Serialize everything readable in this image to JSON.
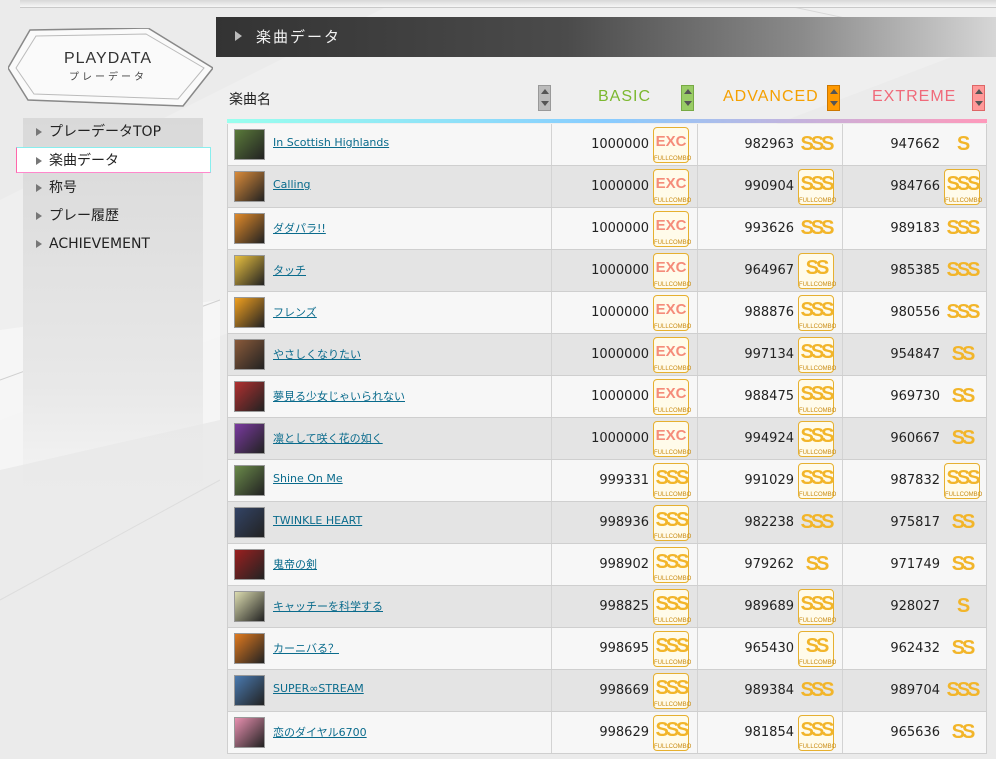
{
  "logo": {
    "title": "PLAYDATA",
    "subtitle": "プレーデータ"
  },
  "sidebar": {
    "items": [
      {
        "label": "プレーデータTOP",
        "active": false
      },
      {
        "label": "楽曲データ",
        "active": true
      },
      {
        "label": "称号",
        "active": false
      },
      {
        "label": "プレー履歴",
        "active": false
      },
      {
        "label": "ACHIEVEMENT",
        "active": false
      }
    ]
  },
  "header": {
    "title": "楽曲データ"
  },
  "table": {
    "col_song": "楽曲名",
    "col_basic": "BASIC",
    "col_advanced": "ADVANCED",
    "col_extreme": "EXTREME",
    "colors": {
      "basic": "#7cb82f",
      "advanced": "#f5a000",
      "extreme": "#f06a7a"
    },
    "rows": [
      {
        "title": "In Scottish Highlands",
        "jacket": "#5a7a3a",
        "basic": "1000000",
        "basic_rank": "EXC",
        "basic_fc": "FULLCOMBO",
        "advanced": "982963",
        "advanced_rank": "SSS",
        "advanced_fc": "",
        "extreme": "947662",
        "extreme_rank": "S",
        "extreme_fc": ""
      },
      {
        "title": "Calling",
        "jacket": "#d98b3a",
        "basic": "1000000",
        "basic_rank": "EXC",
        "basic_fc": "FULLCOMBO",
        "advanced": "990904",
        "advanced_rank": "SSS",
        "advanced_fc": "FULLCOMBO",
        "extreme": "984766",
        "extreme_rank": "SSS",
        "extreme_fc": "FULLCOMBO"
      },
      {
        "title": "ダダパラ!!",
        "jacket": "#e08a2a",
        "basic": "1000000",
        "basic_rank": "EXC",
        "basic_fc": "FULLCOMBO",
        "advanced": "993626",
        "advanced_rank": "SSS",
        "advanced_fc": "",
        "extreme": "989183",
        "extreme_rank": "SSS",
        "extreme_fc": ""
      },
      {
        "title": "タッチ",
        "jacket": "#e8c040",
        "basic": "1000000",
        "basic_rank": "EXC",
        "basic_fc": "FULLCOMBO",
        "advanced": "964967",
        "advanced_rank": "SS",
        "advanced_fc": "FULLCOMBO",
        "extreme": "985385",
        "extreme_rank": "SSS",
        "extreme_fc": ""
      },
      {
        "title": "フレンズ",
        "jacket": "#f0a020",
        "basic": "1000000",
        "basic_rank": "EXC",
        "basic_fc": "FULLCOMBO",
        "advanced": "988876",
        "advanced_rank": "SSS",
        "advanced_fc": "FULLCOMBO",
        "extreme": "980556",
        "extreme_rank": "SSS",
        "extreme_fc": ""
      },
      {
        "title": "やさしくなりたい",
        "jacket": "#8a5a3a",
        "basic": "1000000",
        "basic_rank": "EXC",
        "basic_fc": "FULLCOMBO",
        "advanced": "997134",
        "advanced_rank": "SSS",
        "advanced_fc": "FULLCOMBO",
        "extreme": "954847",
        "extreme_rank": "SS",
        "extreme_fc": ""
      },
      {
        "title": "夢見る少女じゃいられない",
        "jacket": "#b03030",
        "basic": "1000000",
        "basic_rank": "EXC",
        "basic_fc": "FULLCOMBO",
        "advanced": "988475",
        "advanced_rank": "SSS",
        "advanced_fc": "FULLCOMBO",
        "extreme": "969730",
        "extreme_rank": "SS",
        "extreme_fc": ""
      },
      {
        "title": "凛として咲く花の如く",
        "jacket": "#7a3aa0",
        "basic": "1000000",
        "basic_rank": "EXC",
        "basic_fc": "FULLCOMBO",
        "advanced": "994924",
        "advanced_rank": "SSS",
        "advanced_fc": "FULLCOMBO",
        "extreme": "960667",
        "extreme_rank": "SS",
        "extreme_fc": ""
      },
      {
        "title": "Shine On Me",
        "jacket": "#6a8a4a",
        "basic": "999331",
        "basic_rank": "SSS",
        "basic_fc": "FULLCOMBO",
        "advanced": "991029",
        "advanced_rank": "SSS",
        "advanced_fc": "FULLCOMBO",
        "extreme": "987832",
        "extreme_rank": "SSS",
        "extreme_fc": "FULLCOMBO"
      },
      {
        "title": "TWINKLE HEART",
        "jacket": "#334466",
        "basic": "998936",
        "basic_rank": "SSS",
        "basic_fc": "FULLCOMBO",
        "advanced": "982238",
        "advanced_rank": "SSS",
        "advanced_fc": "",
        "extreme": "975817",
        "extreme_rank": "SS",
        "extreme_fc": ""
      },
      {
        "title": "鬼帝の剣",
        "jacket": "#9a2020",
        "basic": "998902",
        "basic_rank": "SSS",
        "basic_fc": "FULLCOMBO",
        "advanced": "979262",
        "advanced_rank": "SS",
        "advanced_fc": "",
        "extreme": "971749",
        "extreme_rank": "SS",
        "extreme_fc": ""
      },
      {
        "title": "キャッチーを科学する",
        "jacket": "#dcdcb0",
        "basic": "998825",
        "basic_rank": "SSS",
        "basic_fc": "FULLCOMBO",
        "advanced": "989689",
        "advanced_rank": "SSS",
        "advanced_fc": "FULLCOMBO",
        "extreme": "928027",
        "extreme_rank": "S",
        "extreme_fc": ""
      },
      {
        "title": "カーニバる？",
        "jacket": "#e07a20",
        "basic": "998695",
        "basic_rank": "SSS",
        "basic_fc": "FULLCOMBO",
        "advanced": "965430",
        "advanced_rank": "SS",
        "advanced_fc": "FULLCOMBO",
        "extreme": "962432",
        "extreme_rank": "SS",
        "extreme_fc": ""
      },
      {
        "title": "SUPER∞STREAM",
        "jacket": "#4a7ab0",
        "basic": "998669",
        "basic_rank": "SSS",
        "basic_fc": "FULLCOMBO",
        "advanced": "989384",
        "advanced_rank": "SSS",
        "advanced_fc": "",
        "extreme": "989704",
        "extreme_rank": "SSS",
        "extreme_fc": ""
      },
      {
        "title": "恋のダイヤル6700",
        "jacket": "#e890b0",
        "basic": "998629",
        "basic_rank": "SSS",
        "basic_fc": "FULLCOMBO",
        "advanced": "981854",
        "advanced_rank": "SSS",
        "advanced_fc": "FULLCOMBO",
        "extreme": "965636",
        "extreme_rank": "SS",
        "extreme_fc": ""
      }
    ]
  }
}
